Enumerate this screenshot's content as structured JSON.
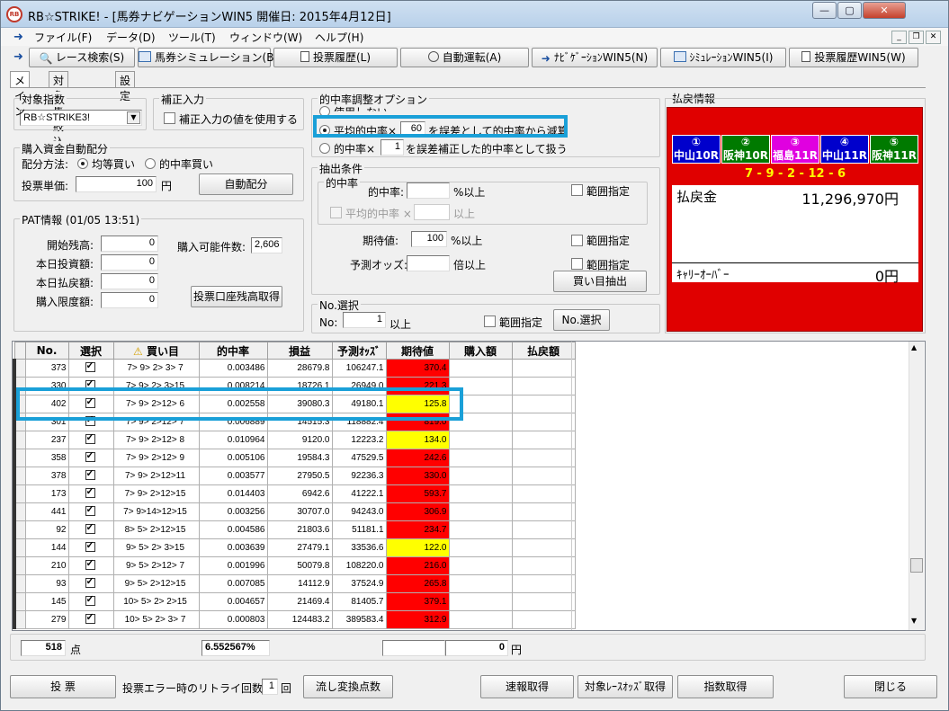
{
  "window": {
    "title": "RB☆STRIKE! - [馬券ナビゲーションWIN5  開催日: 2015年4月12日]"
  },
  "menu": [
    "ファイル(F)",
    "データ(D)",
    "ツール(T)",
    "ウィンドウ(W)",
    "ヘルプ(H)"
  ],
  "toolbar": [
    "レース検索(S)",
    "馬券シミュレーション(B)",
    "投票履歴(L)",
    "自動運転(A)",
    "ﾅﾋﾞｹﾞｰｼｮﾝWIN5(N)",
    "ｼﾐｭﾚｰｼｮﾝWIN5(I)",
    "投票履歴WIN5(W)"
  ],
  "tabs": [
    "メイン",
    "対象馬絞込",
    "設定"
  ],
  "index_group": {
    "title": "対象指数",
    "selected": "RB☆STRIKE3!"
  },
  "correction_group": {
    "title": "補正入力",
    "checkbox": "補正入力の値を使用する"
  },
  "budget_group": {
    "title": "購入資金自動配分",
    "method_label": "配分方法:",
    "opt_equal": "均等買い",
    "opt_hit": "的中率買い",
    "unit_label": "投票単価:",
    "unit_value": "100",
    "unit_suffix": "円",
    "button": "自動配分"
  },
  "pat_group": {
    "title": "PAT情報 (01/05 13:51)",
    "start_balance_label": "開始残高:",
    "start_balance": "0",
    "today_bet_label": "本日投資額:",
    "today_bet": "0",
    "today_refund_label": "本日払戻額:",
    "today_refund": "0",
    "limit_label": "購入限度額:",
    "limit": "0",
    "buyable_label": "購入可能件数:",
    "buyable": "2,606",
    "button": "投票口座残高取得"
  },
  "hit_option_group": {
    "title": "的中率調整オプション",
    "opt_none": "使用しない",
    "opt_avg_prefix": "平均的中率×",
    "avg_value": "60",
    "opt_avg_suffix": "を誤差として的中率から減算",
    "opt_hit_prefix": "的中率×",
    "hit_value": "1",
    "opt_hit_suffix": "を誤差補正した的中率として扱う"
  },
  "extract_group": {
    "title": "抽出条件",
    "sub_title": "的中率",
    "hit_label": "的中率:",
    "hit_unit": "%以上",
    "range1": "範囲指定",
    "avg_label": "平均的中率 ×",
    "avg_unit": "以上",
    "ev_label": "期待値:",
    "ev_value": "100",
    "ev_unit": "%以上",
    "range2": "範囲指定",
    "odds_label": "予測オッズ:",
    "odds_unit": "倍以上",
    "range3": "範囲指定",
    "button": "買い目抽出"
  },
  "no_group": {
    "title": "No.選択",
    "label": "No:",
    "value": "1",
    "unit": "以上",
    "range": "範囲指定",
    "button": "No.選択"
  },
  "payout": {
    "title": "払戻情報",
    "races": [
      {
        "num": "①",
        "name": "中山10R",
        "color": "#0000cc"
      },
      {
        "num": "②",
        "name": "阪神10R",
        "color": "#007a00"
      },
      {
        "num": "③",
        "name": "福島11R",
        "color": "#e000e0"
      },
      {
        "num": "④",
        "name": "中山11R",
        "color": "#0000cc"
      },
      {
        "num": "⑤",
        "name": "阪神11R",
        "color": "#007a00"
      }
    ],
    "combo": "7 - 9 - 2 - 12 - 6",
    "amount_label": "払戻金",
    "amount": "11,296,970円",
    "carry_label": "ｷｬﾘｰｵｰﾊﾞｰ",
    "carry": "0円"
  },
  "grid": {
    "headers": [
      "No.",
      "選択",
      "買い目",
      "的中率",
      "損益",
      "予測ｵｯｽﾞ",
      "期待値",
      "購入額",
      "払戻額"
    ],
    "rows": [
      {
        "no": "373",
        "combo": "7> 9> 2> 3> 7",
        "hit": "0.003486",
        "pl": "28679.8",
        "odds": "106247.1",
        "ev": "370.4",
        "color": "red"
      },
      {
        "no": "330",
        "combo": "7> 9> 2> 3>15",
        "hit": "0.008214",
        "pl": "18726.1",
        "odds": "26949.0",
        "ev": "221.3",
        "color": "red"
      },
      {
        "no": "402",
        "combo": "7> 9> 2>12> 6",
        "hit": "0.002558",
        "pl": "39080.3",
        "odds": "49180.1",
        "ev": "125.8",
        "color": "yel"
      },
      {
        "no": "301",
        "combo": "7> 9> 2>12> 7",
        "hit": "0.006889",
        "pl": "14515.3",
        "odds": "118882.4",
        "ev": "819.0",
        "color": "red"
      },
      {
        "no": "237",
        "combo": "7> 9> 2>12> 8",
        "hit": "0.010964",
        "pl": "9120.0",
        "odds": "12223.2",
        "ev": "134.0",
        "color": "yel"
      },
      {
        "no": "358",
        "combo": "7> 9> 2>12> 9",
        "hit": "0.005106",
        "pl": "19584.3",
        "odds": "47529.5",
        "ev": "242.6",
        "color": "red"
      },
      {
        "no": "378",
        "combo": "7> 9> 2>12>11",
        "hit": "0.003577",
        "pl": "27950.5",
        "odds": "92236.3",
        "ev": "330.0",
        "color": "red"
      },
      {
        "no": "173",
        "combo": "7> 9> 2>12>15",
        "hit": "0.014403",
        "pl": "6942.6",
        "odds": "41222.1",
        "ev": "593.7",
        "color": "red"
      },
      {
        "no": "441",
        "combo": "7> 9>14>12>15",
        "hit": "0.003256",
        "pl": "30707.0",
        "odds": "94243.0",
        "ev": "306.9",
        "color": "red"
      },
      {
        "no": "92",
        "combo": "8> 5> 2>12>15",
        "hit": "0.004586",
        "pl": "21803.6",
        "odds": "51181.1",
        "ev": "234.7",
        "color": "red"
      },
      {
        "no": "144",
        "combo": "9> 5> 2> 3>15",
        "hit": "0.003639",
        "pl": "27479.1",
        "odds": "33536.6",
        "ev": "122.0",
        "color": "yel"
      },
      {
        "no": "210",
        "combo": "9> 5> 2>12> 7",
        "hit": "0.001996",
        "pl": "50079.8",
        "odds": "108220.0",
        "ev": "216.0",
        "color": "red"
      },
      {
        "no": "93",
        "combo": "9> 5> 2>12>15",
        "hit": "0.007085",
        "pl": "14112.9",
        "odds": "37524.9",
        "ev": "265.8",
        "color": "red"
      },
      {
        "no": "145",
        "combo": "10> 5> 2> 2>15",
        "hit": "0.004657",
        "pl": "21469.4",
        "odds": "81405.7",
        "ev": "379.1",
        "color": "red"
      },
      {
        "no": "279",
        "combo": "10> 5> 2> 3> 7",
        "hit": "0.000803",
        "pl": "124483.2",
        "odds": "389583.4",
        "ev": "312.9",
        "color": "red"
      }
    ]
  },
  "footer": {
    "count": "518",
    "count_unit": "点",
    "hit_total": "6.552567%",
    "buy_total": "",
    "refund_total": "0",
    "refund_unit": "円"
  },
  "bottom": {
    "vote": "投 票",
    "retry_label": "投票エラー時のリトライ回数:",
    "retry_value": "1",
    "retry_unit": "回",
    "convert": "流し変換点数",
    "speed": "速報取得",
    "odds": "対象ﾚｰｽｵｯｽﾞ取得",
    "index": "指数取得",
    "close": "閉じる"
  }
}
